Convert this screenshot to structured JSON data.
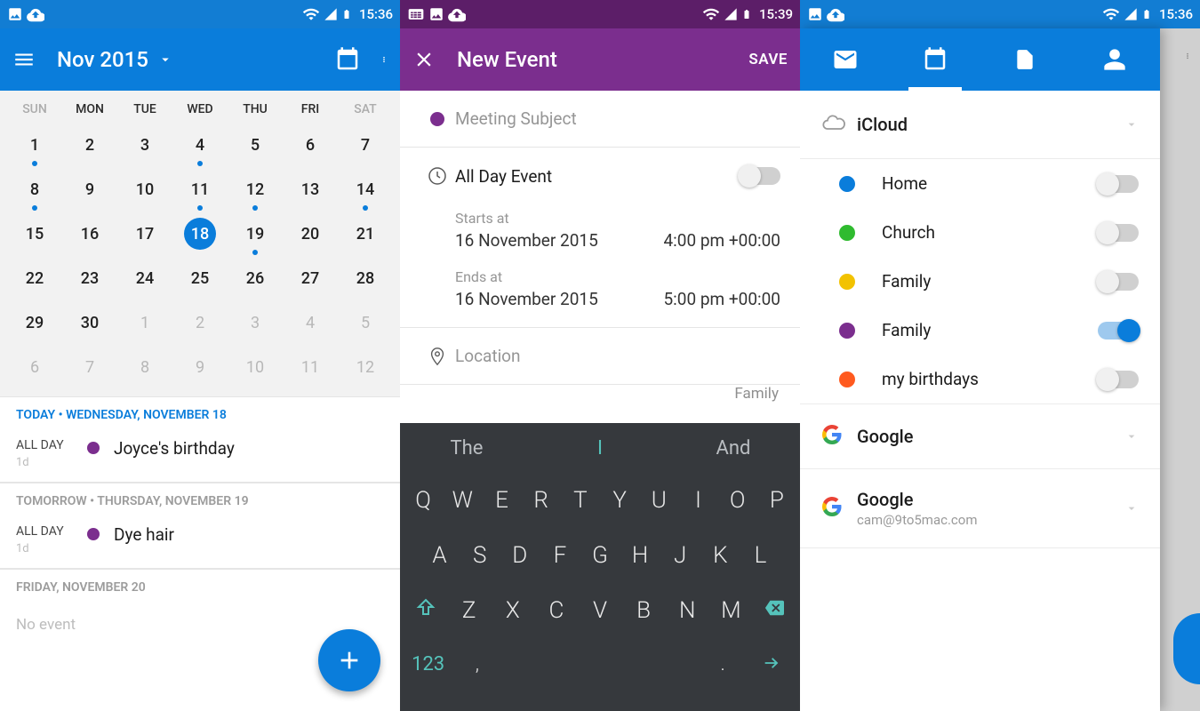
{
  "screen1": {
    "statusbar_time": "15:36",
    "toolbar_month": "Nov 2015",
    "today_date_number": "18",
    "weekdays": [
      "SUN",
      "MON",
      "TUE",
      "WED",
      "THU",
      "FRI",
      "SAT"
    ],
    "rows": [
      [
        "1",
        "2",
        "3",
        "4",
        "5",
        "6",
        "7"
      ],
      [
        "8",
        "9",
        "10",
        "11",
        "12",
        "13",
        "14"
      ],
      [
        "15",
        "16",
        "17",
        "18",
        "19",
        "20",
        "21"
      ],
      [
        "22",
        "23",
        "24",
        "25",
        "26",
        "27",
        "28"
      ],
      [
        "29",
        "30",
        "1",
        "2",
        "3",
        "4",
        "5"
      ],
      [
        "6",
        "7",
        "8",
        "9",
        "10",
        "11",
        "12"
      ]
    ],
    "dots_on": [
      "1",
      "4",
      "8",
      "11",
      "12",
      "14",
      "19"
    ],
    "agenda": {
      "today_header": "TODAY • WEDNESDAY, NOVEMBER 18",
      "item1_time": "ALL DAY",
      "item1_dur": "1d",
      "item1_title": "Joyce's birthday",
      "tomorrow_header": "TOMORROW • THURSDAY, NOVEMBER 19",
      "item2_time": "ALL DAY",
      "item2_dur": "1d",
      "item2_title": "Dye hair",
      "friday_header": "FRIDAY, NOVEMBER 20",
      "noevent": "No event"
    }
  },
  "screen2": {
    "statusbar_time": "15:39",
    "toolbar_title": "New Event",
    "save_label": "SAVE",
    "subject_placeholder": "Meeting Subject",
    "allday_label": "All Day Event",
    "starts_label": "Starts at",
    "starts_date": "16 November 2015",
    "starts_time": "4:00 pm +00:00",
    "ends_label": "Ends at",
    "ends_date": "16 November 2015",
    "ends_time": "5:00 pm +00:00",
    "location_label": "Location",
    "cal_peek": "Family",
    "kb_suggest": [
      "The",
      "I",
      "And"
    ],
    "kb_row1": [
      "Q",
      "W",
      "E",
      "R",
      "T",
      "Y",
      "U",
      "I",
      "O",
      "P"
    ],
    "kb_row2": [
      "A",
      "S",
      "D",
      "F",
      "G",
      "H",
      "J",
      "K",
      "L"
    ],
    "kb_row3": [
      "Z",
      "X",
      "C",
      "V",
      "B",
      "N",
      "M"
    ],
    "kb_123": "123"
  },
  "screen3": {
    "statusbar_time": "15:36",
    "acct1_name": "iCloud",
    "cal_items": [
      {
        "color": "#0a7ddb",
        "label": "Home",
        "on": false
      },
      {
        "color": "#2fbb2f",
        "label": "Church",
        "on": false
      },
      {
        "color": "#f2c200",
        "label": "Family",
        "on": false
      },
      {
        "color": "#7b2e8e",
        "label": "Family",
        "on": true
      },
      {
        "color": "#ff5a1f",
        "label": "my birthdays",
        "on": false
      }
    ],
    "acct2_name": "Google",
    "acct3_name": "Google",
    "acct3_email": "cam@9to5mac.com"
  }
}
